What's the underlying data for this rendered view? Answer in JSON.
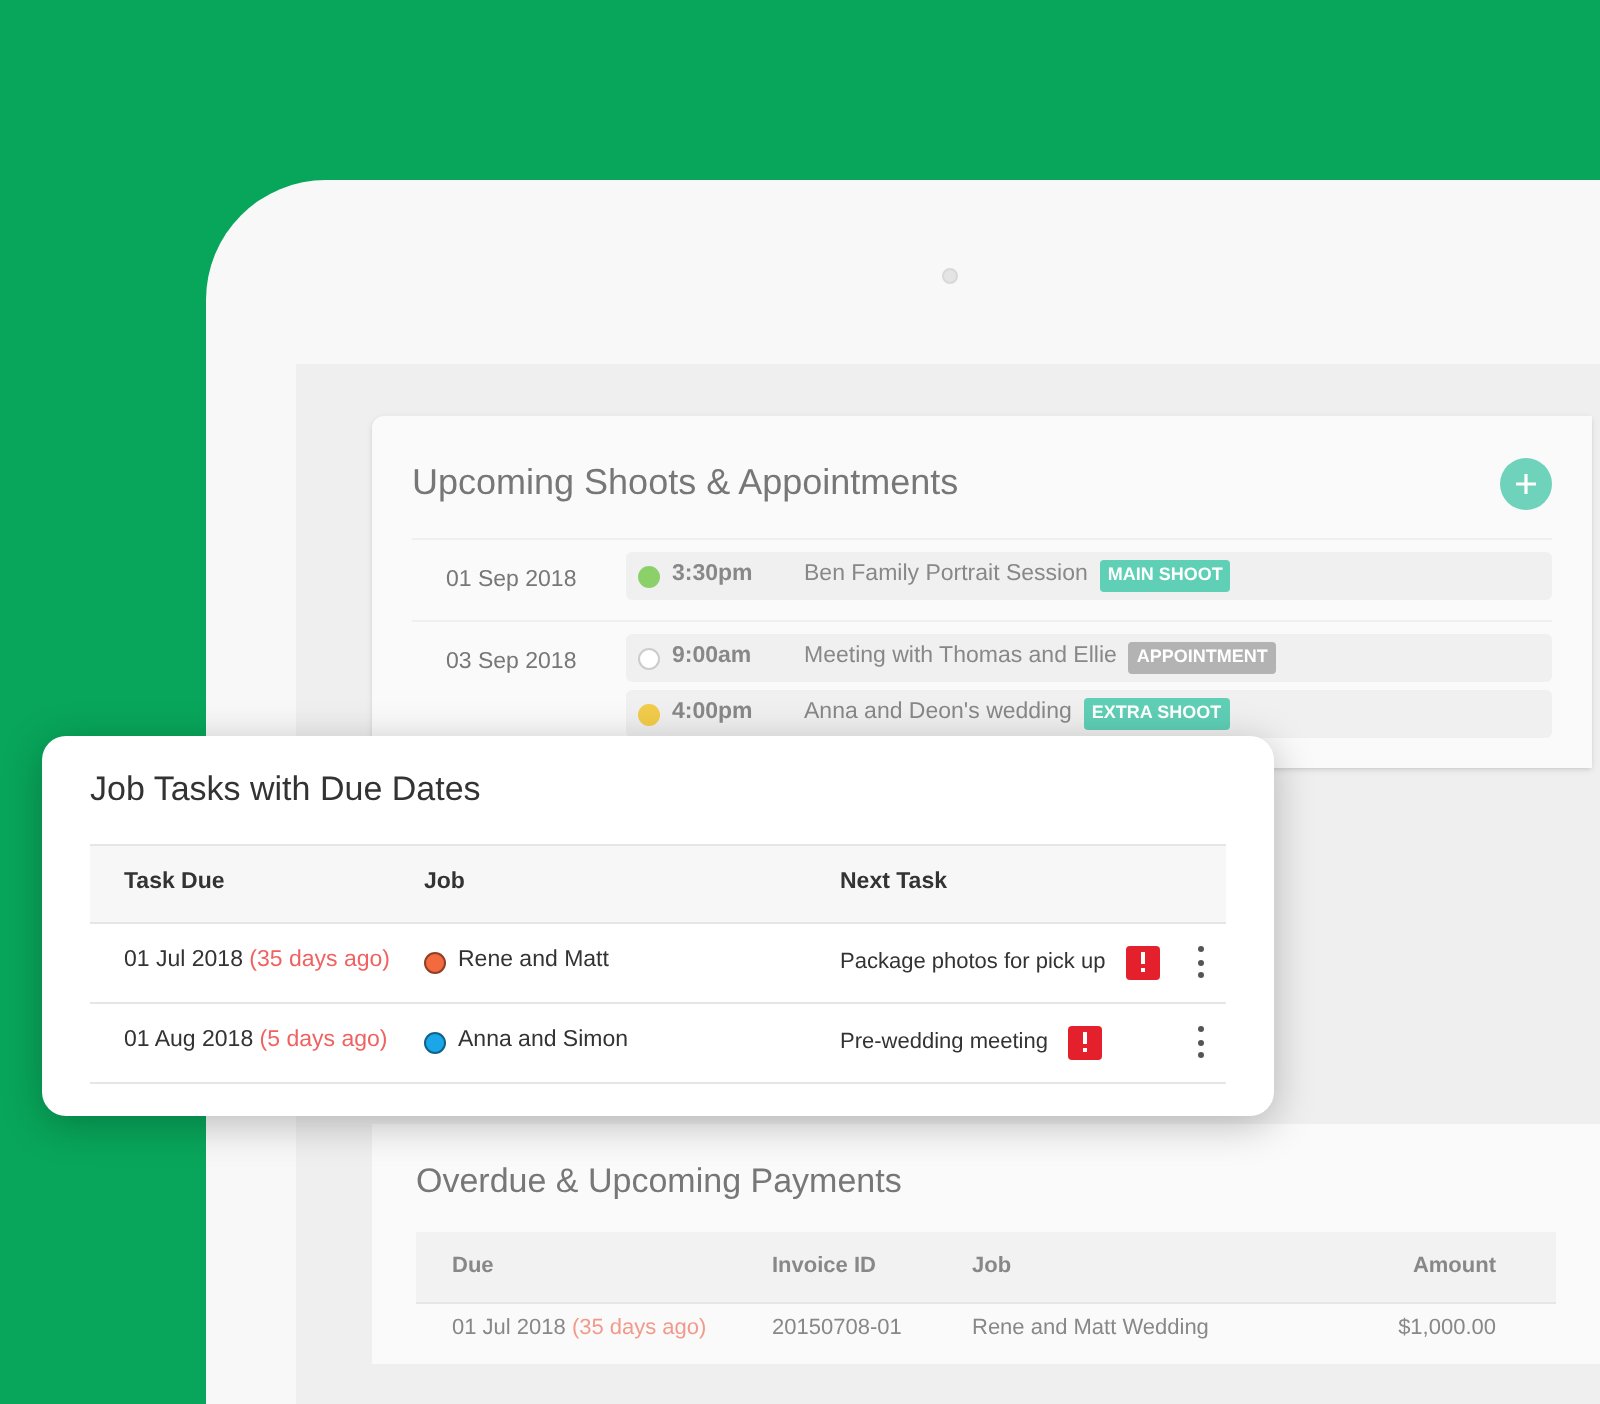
{
  "upcoming": {
    "title": "Upcoming Shoots & Appointments",
    "days": [
      {
        "date": "01 Sep 2018",
        "events": [
          {
            "kind": "filled",
            "color": "#8cd06a",
            "time": "3:30pm",
            "title": "Ben Family Portrait Session",
            "tag": {
              "text": "MAIN SHOOT",
              "color": "#5fcfb5"
            }
          }
        ]
      },
      {
        "date": "03 Sep 2018",
        "events": [
          {
            "kind": "hollow",
            "time": "9:00am",
            "title": "Meeting with Thomas and Ellie",
            "tag": {
              "text": "APPOINTMENT",
              "color": "#b3b3b3"
            }
          },
          {
            "kind": "filled",
            "color": "#f2cc4a",
            "time": "4:00pm",
            "title": "Anna and Deon's wedding",
            "tag": {
              "text": "EXTRA SHOOT",
              "color": "#5fcfb5"
            }
          }
        ]
      }
    ]
  },
  "job_tasks": {
    "title": "Job Tasks with Due Dates",
    "columns": [
      "Task Due",
      "Job",
      "Next Task"
    ],
    "rows": [
      {
        "due": "01 Jul 2018",
        "overdue": "(35 days ago)",
        "job": "Rene and Matt",
        "color": "#f26a3d",
        "next_task": "Package photos for pick up",
        "flagged": true
      },
      {
        "due": "01 Aug 2018",
        "overdue": "(5 days ago)",
        "job": "Anna and Simon",
        "color": "#1aa6e8",
        "next_task": "Pre-wedding meeting",
        "flagged": true
      }
    ]
  },
  "payments": {
    "title": "Overdue & Upcoming Payments",
    "columns": [
      "Due",
      "Invoice ID",
      "Job",
      "Amount"
    ],
    "rows": [
      {
        "due": "01 Jul 2018",
        "overdue": "(35 days ago)",
        "invoice_id": "20150708-01",
        "job": "Rene and Matt Wedding",
        "amount": "$1,000.00"
      }
    ]
  }
}
